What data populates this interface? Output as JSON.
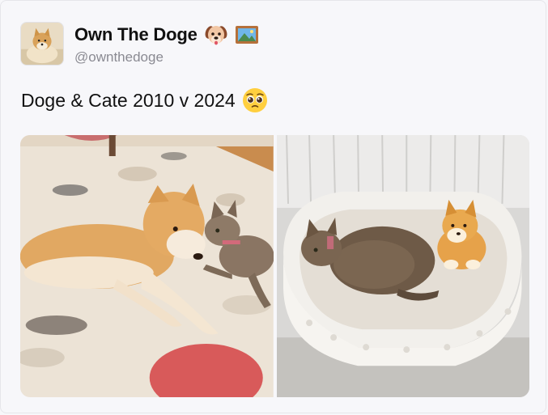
{
  "post": {
    "author": {
      "display_name": "Own The Doge",
      "handle": "@ownthedoge",
      "badges": [
        "dog-face-emoji-icon",
        "framed-picture-emoji-icon"
      ]
    },
    "text": "Doge & Cate 2010 v 2024",
    "text_emoji": "pleading-face-emoji-icon",
    "media": [
      {
        "icon": "dog-and-cat-2010-photo"
      },
      {
        "icon": "cat-in-basket-with-plush-doge-2024-photo"
      }
    ]
  },
  "colors": {
    "background": "#f7f7fa",
    "text": "#111111",
    "handle": "#8a8a92"
  }
}
